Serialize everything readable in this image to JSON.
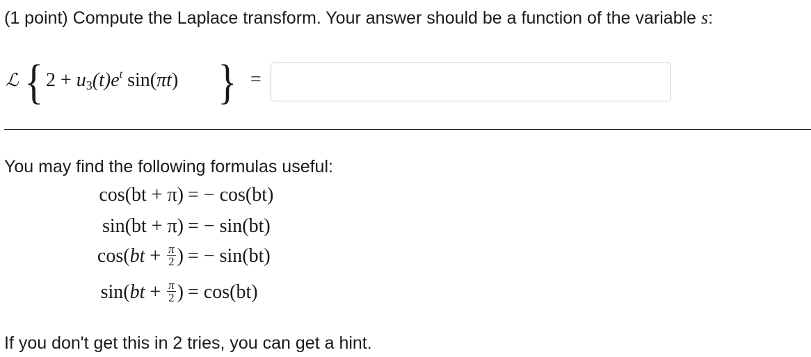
{
  "problem": {
    "points": "(1 point)",
    "prompt_text": "Compute the Laplace transform. Your answer should be a function of the variable",
    "variable": "s",
    "colon": ":"
  },
  "equation": {
    "operator": "ℒ",
    "constant": "2",
    "plus": "+",
    "u": "u",
    "u_sub": "3",
    "arg_t": "(t)",
    "e": "e",
    "e_sup": "t",
    "sin_open": "sin(",
    "pi": "π",
    "t": "t",
    "close": ")",
    "equals": "="
  },
  "answer_input": {
    "value": "",
    "placeholder": ""
  },
  "formulas": {
    "intro": "You may find the following formulas useful:",
    "rows": [
      {
        "lhs": "cos(bt + π)",
        "rhs": "= − cos(bt)"
      },
      {
        "lhs": "sin(bt + π)",
        "rhs": "= − sin(bt)"
      },
      {
        "lhs_func": "cos(",
        "lhs_b": "bt",
        "lhs_plus": " + ",
        "frac_num": "π",
        "frac_den": "2",
        "lhs_close": ")",
        "rhs": "= − sin(bt)"
      },
      {
        "lhs_func": "sin(",
        "lhs_b": "bt",
        "lhs_plus": " + ",
        "frac_num": "π",
        "frac_den": "2",
        "lhs_close": ")",
        "rhs": "= cos(bt)"
      }
    ]
  },
  "hint_text": "If you don't get this in 2 tries, you can get a hint."
}
